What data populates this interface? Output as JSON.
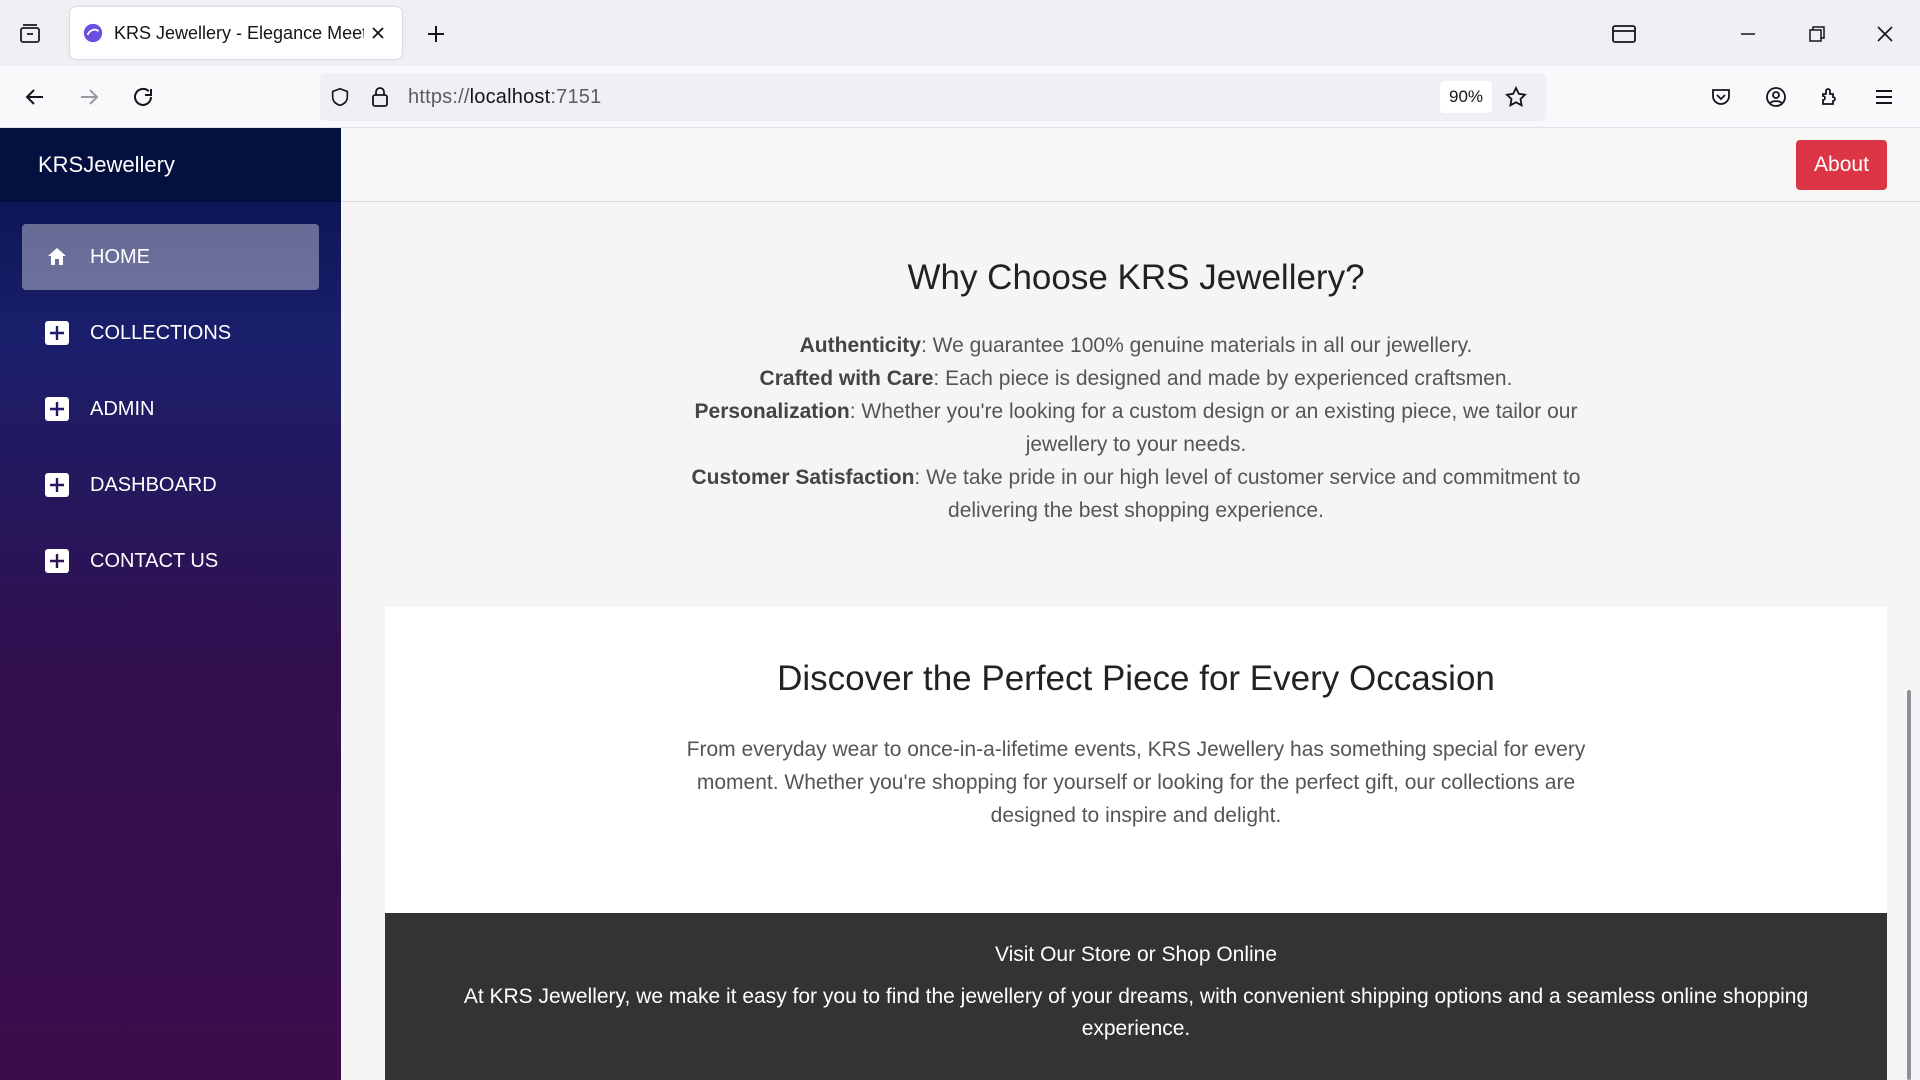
{
  "browser": {
    "tab_title": "KRS Jewellery - Elegance Meets",
    "url_prefix": "https://",
    "url_host": "localhost",
    "url_port": ":7151",
    "zoom": "90%"
  },
  "sidebar": {
    "brand": "KRSJewellery",
    "items": [
      {
        "label": "HOME",
        "icon": "home-icon",
        "active": true
      },
      {
        "label": "COLLECTIONS",
        "icon": "plus-square-icon",
        "active": false
      },
      {
        "label": "ADMIN",
        "icon": "plus-square-icon",
        "active": false
      },
      {
        "label": "DASHBOARD",
        "icon": "plus-square-icon",
        "active": false
      },
      {
        "label": "CONTACT US",
        "icon": "plus-square-icon",
        "active": false
      }
    ]
  },
  "topbar": {
    "about_label": "About",
    "about_color": "#dc3545"
  },
  "why": {
    "title": "Why Choose KRS Jewellery?",
    "points": [
      {
        "term": "Authenticity",
        "text": ": We guarantee 100% genuine materials in all our jewellery."
      },
      {
        "term": "Crafted with Care",
        "text": ": Each piece is designed and made by experienced craftsmen."
      },
      {
        "term": "Personalization",
        "text": ": Whether you're looking for a custom design or an existing piece, we tailor our jewellery to your needs."
      },
      {
        "term": "Customer Satisfaction",
        "text": ": We take pride in our high level of customer service and commitment to delivering the best shopping experience."
      }
    ]
  },
  "discover": {
    "title": "Discover the Perfect Piece for Every Occasion",
    "text": "From everyday wear to once-in-a-lifetime events, KRS Jewellery has something special for every moment. Whether you're shopping for yourself or looking for the perfect gift, our collections are designed to inspire and delight."
  },
  "store": {
    "title": "Visit Our Store or Shop Online",
    "text": "At KRS Jewellery, we make it easy for you to find the jewellery of your dreams, with convenient shipping options and a seamless online shopping experience."
  }
}
